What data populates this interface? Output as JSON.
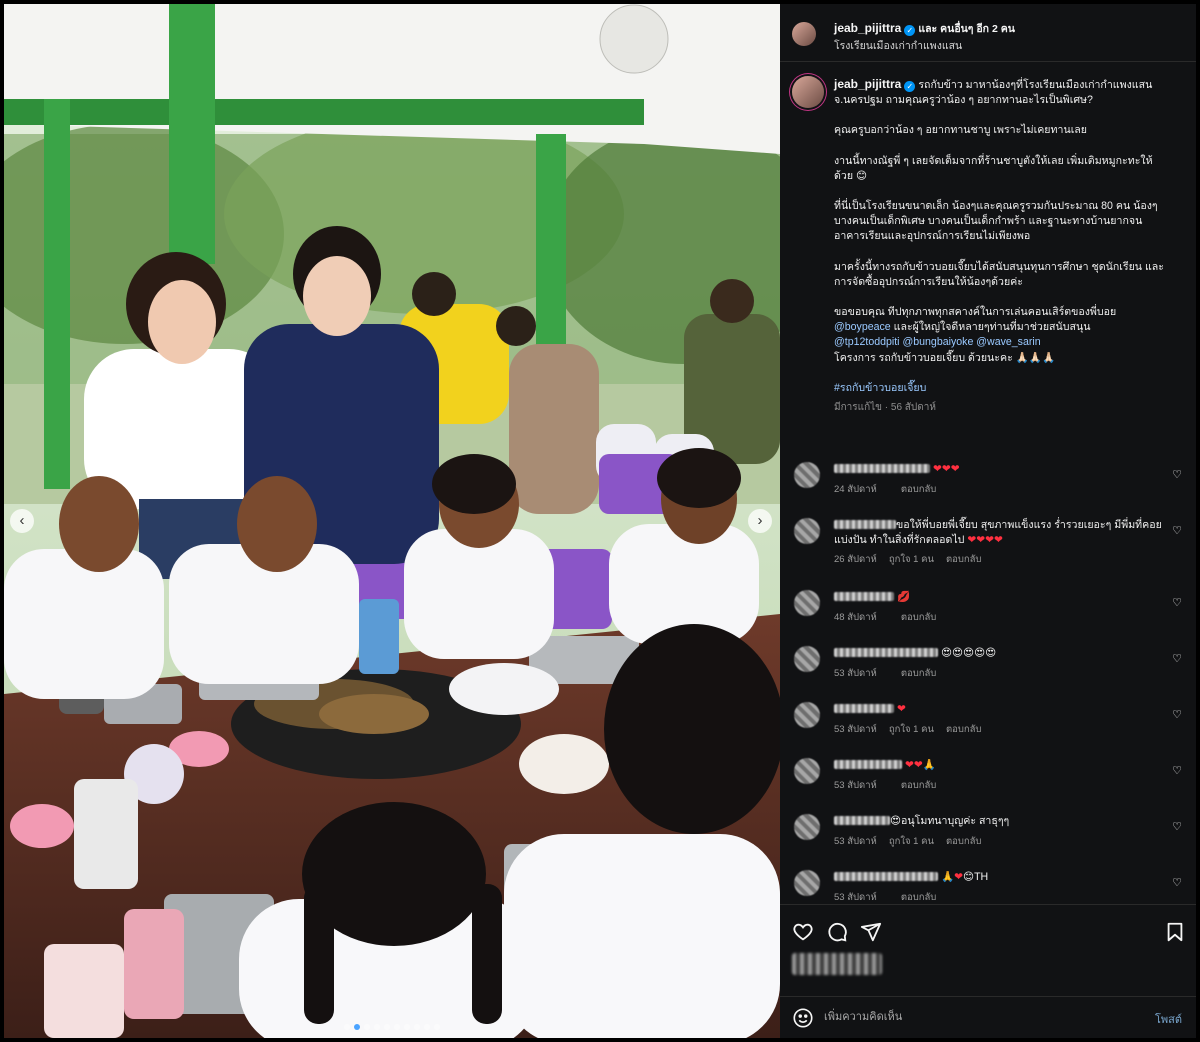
{
  "header": {
    "username": "jeab_pijittra",
    "coauthors": "และ คนอื่นๆ อีก 2 คน",
    "location": "โรงเรียนเมืองเก่ากำแพงแสน"
  },
  "caption": {
    "username": "jeab_pijittra",
    "paragraphs": [
      "รถกับข้าว มาหาน้องๆที่โรงเรียนเมืองเก่ากำแพงแสน จ.นครปฐม ถามคุณครูว่าน้อง ๆ อยากทานอะไรเป็นพิเศษ?",
      "คุณครูบอกว่าน้อง ๆ อยากทานชาบู เพราะไม่เคยทานเลย",
      "งานนี้ทางณัฐพี่ ๆ เลยจัดเต็มจากที่ร้านชาบูตังให้เลย เพิ่มเติมหมูกะทะให้ด้วย 😊",
      "ที่นี่เป็นโรงเรียนขนาดเล็ก น้องๆและคุณครูรวมกันประมาณ 80 คน น้องๆบางคนเป็นเด็กพิเศษ บางคนเป็นเด็กกำพร้า และฐานะทางบ้านยากจน อาคารเรียนและอุปกรณ์การเรียนไม่เพียงพอ",
      "มาครั้งนี้ทางรถกับข้าวบอยเจี๊ยบได้สนับสนุนทุนการศึกษา ชุดนักเรียน และการจัดซื้ออุปกรณ์การเรียนให้น้องๆด้วยค่ะ"
    ],
    "thanks_line1": "ขอขอบคุณ ทีปทุกภาพทุกสคางค์ในการเล่นคอนเสิร์ตของพี่บอย",
    "mention1": "@boypeace",
    "thanks_line2": " และผู้ใหญ่ใจดีหลายๆท่านที่มาช่วยสนับสนุน",
    "mention2": "@tp12toddpiti",
    "mention3": "@bungbaiyoke",
    "mention4": "@wave_sarin",
    "closing": "โครงการ รถกับข้าวบอยเจี๊ยบ ด้วยนะคะ 🙏🏻🙏🏻🙏🏻",
    "hashtag": "#รถกับข้าวบอยเจี๊ยบ",
    "edited": "มีการแก้ไข · 56 สัปดาห์"
  },
  "comments": [
    {
      "text": " ❤️❤️❤️",
      "time": "24 สัปดาห์",
      "likes": "",
      "reply": "ตอบกลับ",
      "blur": 96
    },
    {
      "text": "ขอให้พี่บอยพี่เจี๊ยบ สุขภาพแข็งแรง ร่ำรวยเยอะๆ มีพี่มที่คอยแบ่งปัน ทำในสิ่งที่รักตลอดไป ❤️❤️❤️❤️",
      "time": "26 สัปดาห์",
      "likes": "ถูกใจ 1 คน",
      "reply": "ตอบกลับ",
      "blur": 62
    },
    {
      "text": " 💋",
      "time": "48 สัปดาห์",
      "likes": "",
      "reply": "ตอบกลับ",
      "blur": 60
    },
    {
      "text": " 😍😍😍😍😍",
      "time": "53 สัปดาห์",
      "likes": "",
      "reply": "ตอบกลับ",
      "blur": 104
    },
    {
      "text": " ❤️",
      "time": "53 สัปดาห์",
      "likes": "ถูกใจ 1 คน",
      "reply": "ตอบกลับ",
      "blur": 60
    },
    {
      "text": " ❤️❤️🙏",
      "time": "53 สัปดาห์",
      "likes": "",
      "reply": "ตอบกลับ",
      "blur": 68
    },
    {
      "text": "😍อนุโมทนาบุญค่ะ สาธุๆๆ",
      "time": "53 สัปดาห์",
      "likes": "ถูกใจ 1 คน",
      "reply": "ตอบกลับ",
      "blur": 56
    },
    {
      "text": " 🙏❤️😊TH",
      "time": "53 สัปดาห์",
      "likes": "",
      "reply": "ตอบกลับ",
      "blur": 104
    }
  ],
  "compose": {
    "placeholder": "เพิ่มความคิดเห็น",
    "post": "โพสต์"
  },
  "carousel": {
    "total_slides": 10,
    "current_slide": 2
  },
  "icons": [
    "heart-icon",
    "comment-icon",
    "share-icon",
    "bookmark-icon",
    "emoji-icon",
    "chevron-left-icon",
    "chevron-right-icon"
  ],
  "colors": {
    "background": "#000000",
    "panel": "#111214",
    "verified": "#0095f6",
    "like": "#ff3040",
    "link": "#9ac9ff"
  }
}
